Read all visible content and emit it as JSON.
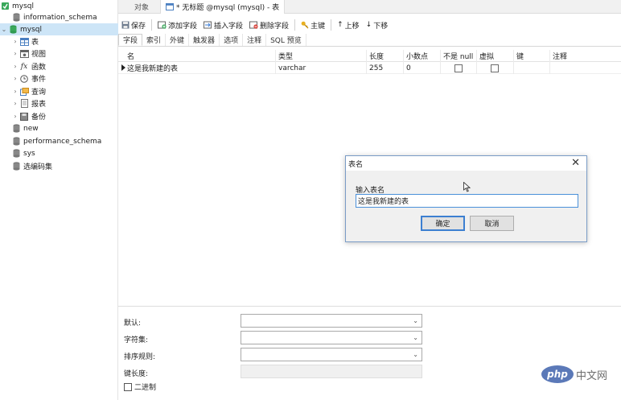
{
  "sidebar": {
    "connection": "mysql",
    "items": [
      {
        "label": "information_schema"
      },
      {
        "label": "mysql"
      },
      {
        "label": "表"
      },
      {
        "label": "视图"
      },
      {
        "label": "函数"
      },
      {
        "label": "事件"
      },
      {
        "label": "查询"
      },
      {
        "label": "报表"
      },
      {
        "label": "备份"
      },
      {
        "label": "new"
      },
      {
        "label": "performance_schema"
      },
      {
        "label": "sys"
      },
      {
        "label": "选编码集"
      }
    ]
  },
  "tabs": [
    {
      "label": "对象"
    },
    {
      "label": "* 无标题 @mysql (mysql) - 表"
    }
  ],
  "toolbar": {
    "save": "保存",
    "add_field": "添加字段",
    "insert_field": "插入字段",
    "delete_field": "删除字段",
    "primary_key": "主键",
    "move_up": "上移",
    "move_down": "下移"
  },
  "subtabs": [
    "字段",
    "索引",
    "外键",
    "触发器",
    "选项",
    "注释",
    "SQL 预览"
  ],
  "grid": {
    "headers": [
      "名",
      "类型",
      "长度",
      "小数点",
      "不是 null",
      "虚拟",
      "键",
      "注释"
    ],
    "rows": [
      {
        "name": "这是我新建的表",
        "type": "varchar",
        "length": "255",
        "decimals": "0",
        "not_null": false,
        "virtual": false,
        "key": "",
        "comment": ""
      }
    ]
  },
  "props": {
    "default_label": "默认:",
    "charset_label": "字符集:",
    "collation_label": "排序规则:",
    "key_length_label": "键长度:",
    "binary_label": "二进制"
  },
  "dialog": {
    "title": "表名",
    "close": "✕",
    "prompt": "输入表名",
    "value": "这是我新建的表",
    "ok": "确定",
    "cancel": "取消"
  },
  "watermark": {
    "logo": "php",
    "text": "中文网"
  }
}
